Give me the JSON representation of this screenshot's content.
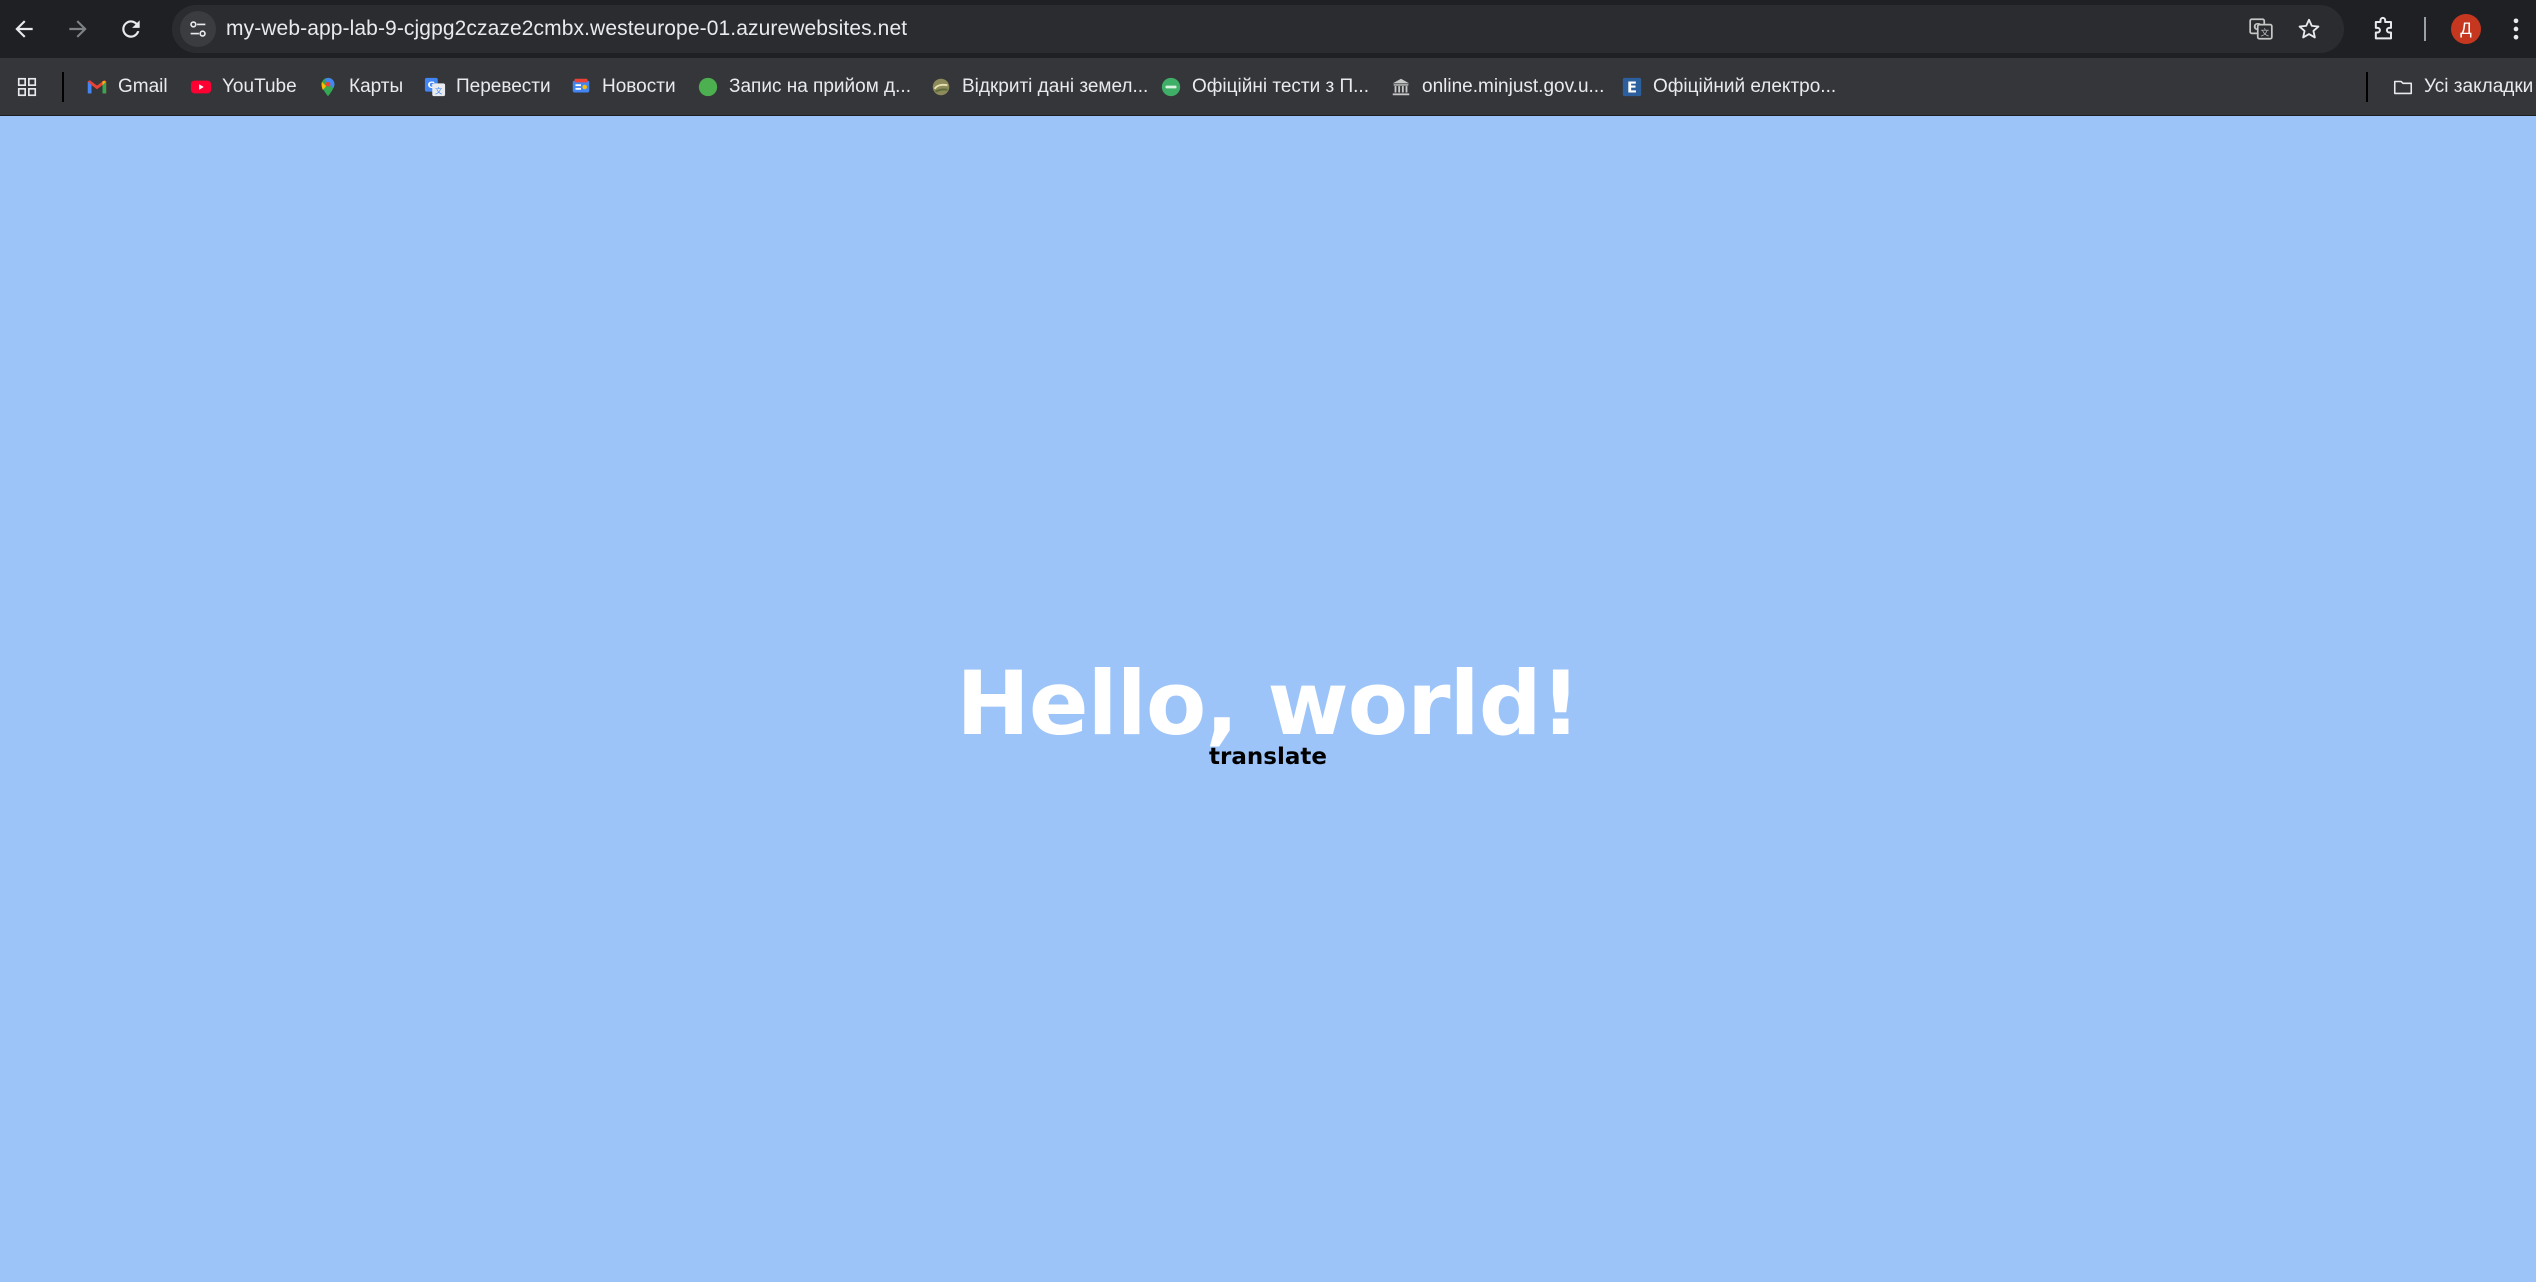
{
  "browser": {
    "url": "my-web-app-lab-9-cjgpg2czaze2cmbx.westeurope-01.azurewebsites.net",
    "profile_initial": "Д",
    "bookmarks": [
      {
        "label": "Gmail",
        "icon": "gmail-icon"
      },
      {
        "label": "YouTube",
        "icon": "youtube-icon"
      },
      {
        "label": "Карты",
        "icon": "maps-icon"
      },
      {
        "label": "Перевести",
        "icon": "translate-icon"
      },
      {
        "label": "Новости",
        "icon": "news-icon"
      },
      {
        "label": "Запис на прийом д...",
        "icon": "green-circle-icon"
      },
      {
        "label": "Відкриті дані земел...",
        "icon": "land-data-icon"
      },
      {
        "label": "Офіційні тести з П...",
        "icon": "tests-icon"
      },
      {
        "label": "online.minjust.gov.u...",
        "icon": "institution-icon"
      },
      {
        "label": "Офіційний електро...",
        "icon": "e-icon"
      }
    ],
    "all_bookmarks_label": "Усі закладки"
  },
  "page": {
    "heading": "Hello, world!",
    "link": "translate"
  },
  "colors": {
    "page_background": "#9dc4f8",
    "toolbar": "#1f2023",
    "bookmarks_bar": "#35363a",
    "avatar": "#c5381f"
  }
}
